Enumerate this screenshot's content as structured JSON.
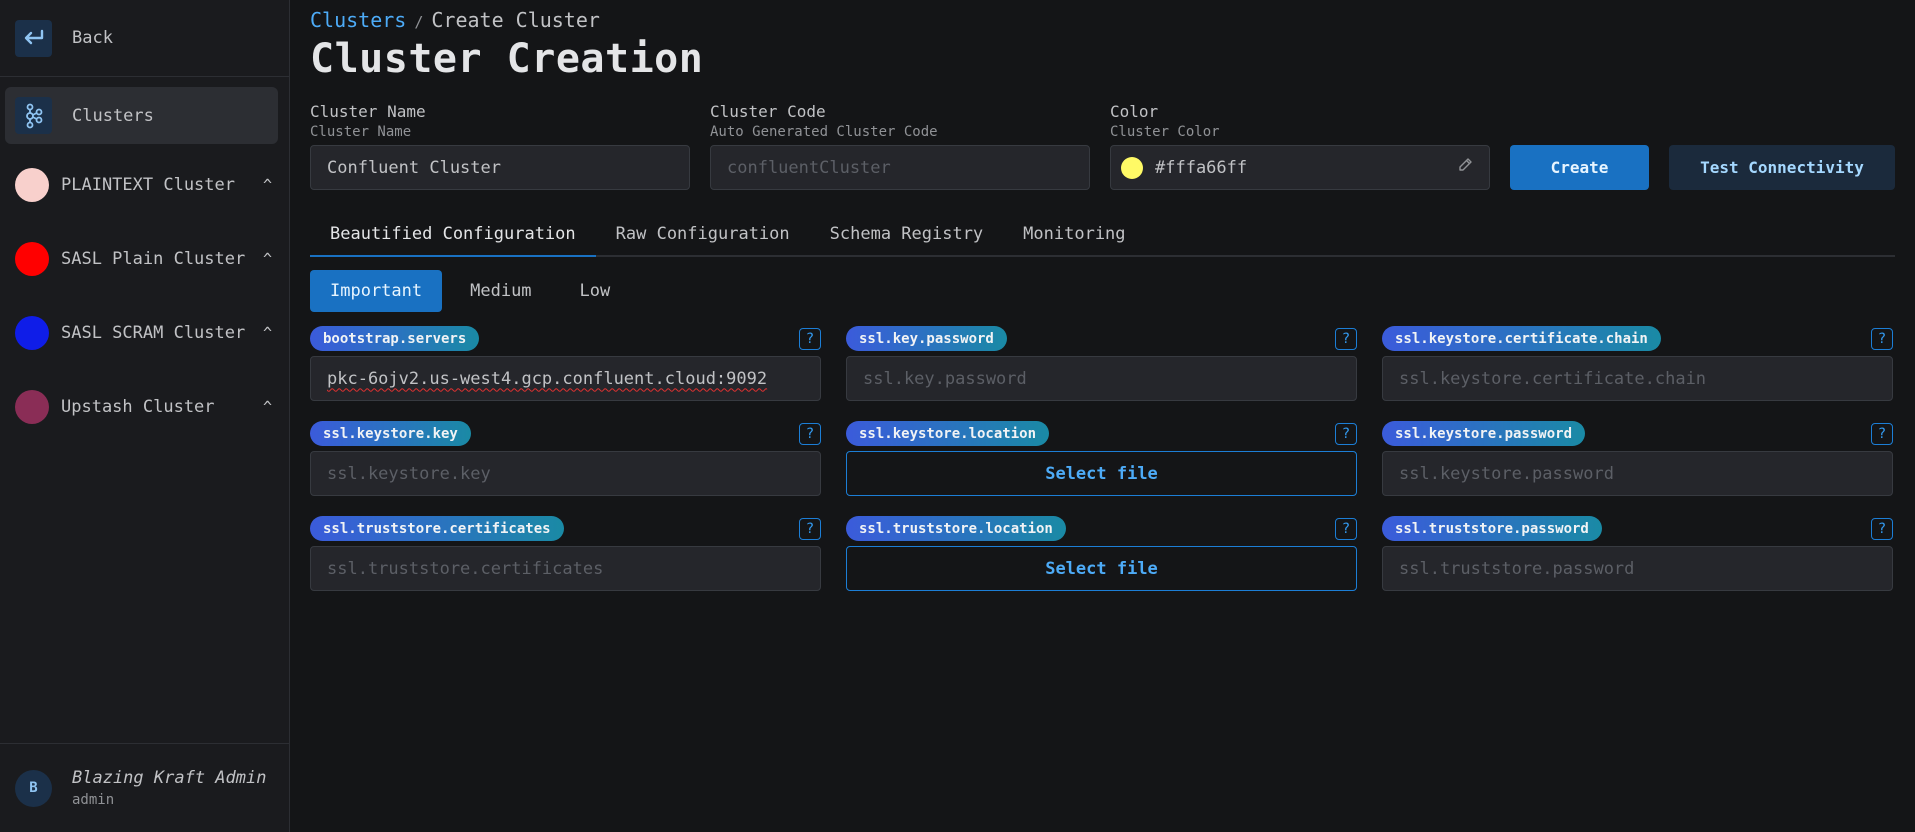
{
  "sidebar": {
    "back_label": "Back",
    "clusters_label": "Clusters",
    "clusters": [
      {
        "name": "PLAINTEXT Cluster",
        "color": "#f8d0cc"
      },
      {
        "name": "SASL Plain Cluster",
        "color": "#ff0000"
      },
      {
        "name": "SASL SCRAM Cluster",
        "color": "#0f1de8"
      },
      {
        "name": "Upstash Cluster",
        "color": "#8a2d56"
      }
    ],
    "user": {
      "initial": "B",
      "name": "Blazing Kraft Admin",
      "role": "admin"
    }
  },
  "breadcrumb": {
    "parent": "Clusters",
    "separator": "/",
    "current": "Create Cluster"
  },
  "page_title": "Cluster Creation",
  "form": {
    "cluster_name": {
      "label": "Cluster Name",
      "description": "Cluster Name",
      "value": "Confluent Cluster"
    },
    "cluster_code": {
      "label": "Cluster Code",
      "description": "Auto Generated Cluster Code",
      "placeholder": "confluentCluster"
    },
    "color": {
      "label": "Color",
      "description": "Cluster Color",
      "value": "#fffa66ff",
      "swatch": "#fffa66"
    },
    "create_label": "Create",
    "test_label": "Test Connectivity"
  },
  "tabs": [
    {
      "label": "Beautified Configuration",
      "active": true
    },
    {
      "label": "Raw Configuration",
      "active": false
    },
    {
      "label": "Schema Registry",
      "active": false
    },
    {
      "label": "Monitoring",
      "active": false
    }
  ],
  "levels": [
    {
      "label": "Important",
      "active": true
    },
    {
      "label": "Medium",
      "active": false
    },
    {
      "label": "Low",
      "active": false
    }
  ],
  "config_fields": [
    {
      "key": "bootstrap.servers",
      "type": "text",
      "value": "pkc-6ojv2.us-west4.gcp.confluent.cloud:9092",
      "placeholder": ""
    },
    {
      "key": "ssl.key.password",
      "type": "text",
      "value": "",
      "placeholder": "ssl.key.password"
    },
    {
      "key": "ssl.keystore.certificate.chain",
      "type": "text",
      "value": "",
      "placeholder": "ssl.keystore.certificate.chain"
    },
    {
      "key": "ssl.keystore.key",
      "type": "text",
      "value": "",
      "placeholder": "ssl.keystore.key"
    },
    {
      "key": "ssl.keystore.location",
      "type": "file",
      "button_label": "Select file"
    },
    {
      "key": "ssl.keystore.password",
      "type": "text",
      "value": "",
      "placeholder": "ssl.keystore.password"
    },
    {
      "key": "ssl.truststore.certificates",
      "type": "text",
      "value": "",
      "placeholder": "ssl.truststore.certificates"
    },
    {
      "key": "ssl.truststore.location",
      "type": "file",
      "button_label": "Select file"
    },
    {
      "key": "ssl.truststore.password",
      "type": "text",
      "value": "",
      "placeholder": "ssl.truststore.password"
    }
  ],
  "help_glyph": "?",
  "colors": {
    "accent": "#1971c2",
    "link": "#4dabf7",
    "background": "#141517",
    "sidebar": "#1a1b1e"
  }
}
